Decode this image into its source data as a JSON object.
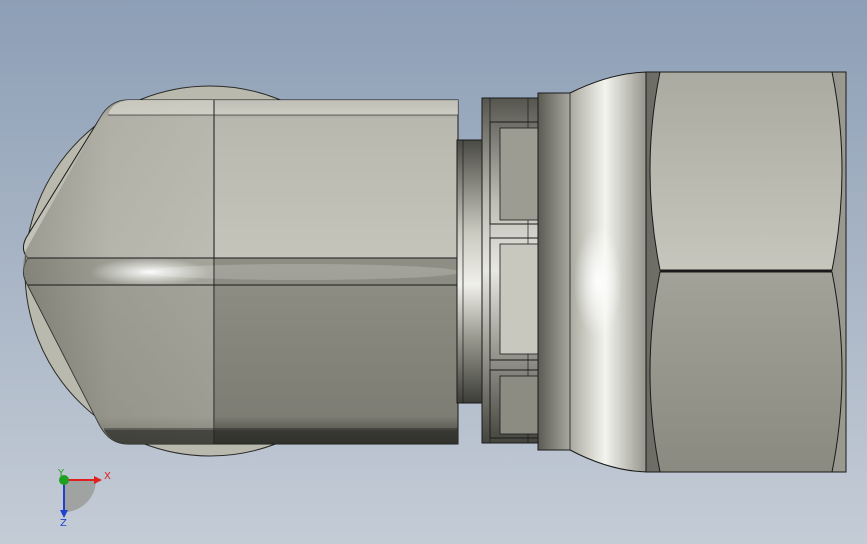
{
  "viewport": {
    "background_top": "#8d9fb6",
    "background_bottom": "#c4ccd6"
  },
  "model": {
    "part": "elbow-fitting",
    "material_color": "#9a9a8f",
    "edge_color": "#1a1a1a"
  },
  "triad": {
    "x_label": "X",
    "y_label": "Y",
    "z_label": "Z",
    "x_color": "#e02020",
    "y_color": "#20a020",
    "z_color": "#2040d0"
  }
}
